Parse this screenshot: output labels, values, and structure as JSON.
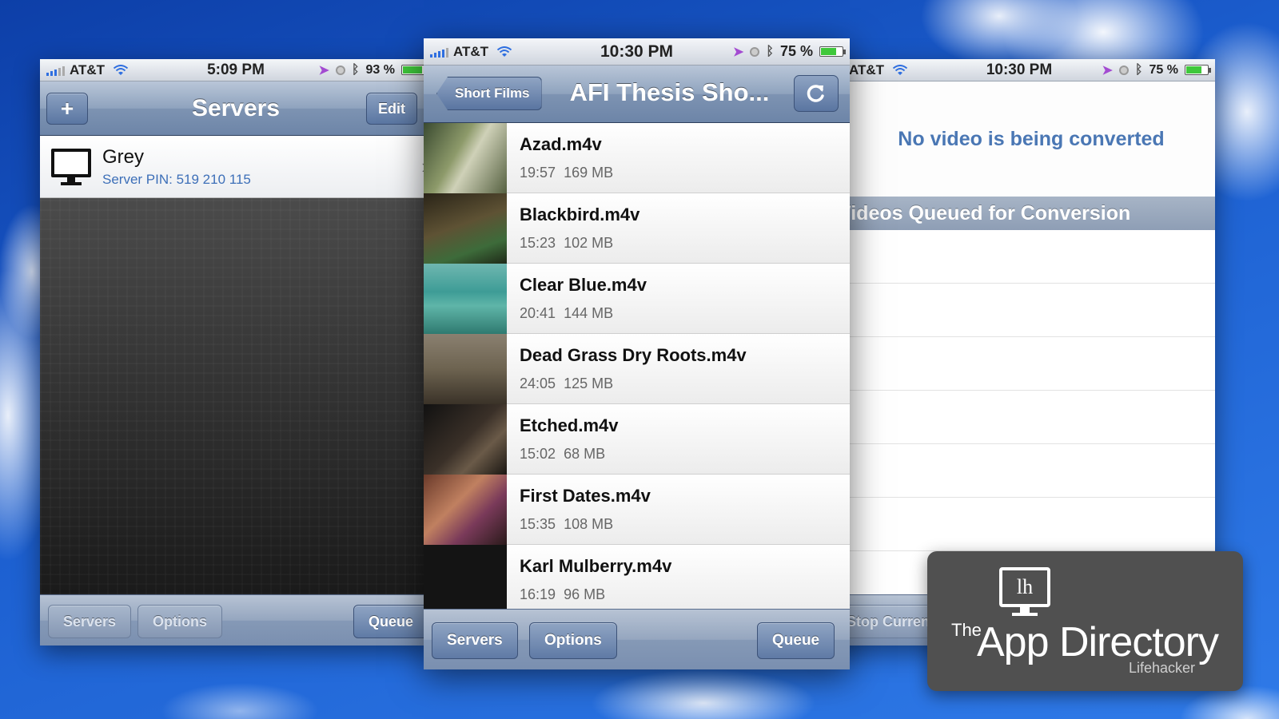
{
  "left_phone": {
    "status": {
      "carrier": "AT&T",
      "time": "5:09 PM",
      "battery": "93 %",
      "battery_level": 0.93
    },
    "nav": {
      "add_label": "+",
      "title": "Servers",
      "edit_label": "Edit"
    },
    "server": {
      "name": "Grey",
      "pin": "Server PIN:  519 210 115"
    },
    "toolbar": {
      "servers": "Servers",
      "options": "Options",
      "queue": "Queue"
    }
  },
  "center_phone": {
    "status": {
      "carrier": "AT&T",
      "time": "10:30 PM",
      "battery": "75 %",
      "battery_level": 0.75
    },
    "nav": {
      "back_label": "Short Films",
      "title": "AFI Thesis Sho...",
      "refresh_icon": "refresh-icon"
    },
    "files": [
      {
        "name": "Azad.m4v",
        "duration": "19:57",
        "size": "169 MB"
      },
      {
        "name": "Blackbird.m4v",
        "duration": "15:23",
        "size": "102 MB"
      },
      {
        "name": "Clear Blue.m4v",
        "duration": "20:41",
        "size": "144 MB"
      },
      {
        "name": "Dead Grass Dry Roots.m4v",
        "duration": "24:05",
        "size": "125 MB"
      },
      {
        "name": "Etched.m4v",
        "duration": "15:02",
        "size": "68 MB"
      },
      {
        "name": "First Dates.m4v",
        "duration": "15:35",
        "size": "108 MB"
      },
      {
        "name": "Karl Mulberry.m4v",
        "duration": "16:19",
        "size": "96 MB"
      }
    ],
    "toolbar": {
      "servers": "Servers",
      "options": "Options",
      "queue": "Queue"
    }
  },
  "right_phone": {
    "status": {
      "carrier": "AT&T",
      "time": "10:30 PM",
      "battery": "75 %",
      "battery_level": 0.75
    },
    "no_video_message": "No video is being converted",
    "queue_header": "Videos Queued for Conversion",
    "toolbar": {
      "stop_current": "Stop Curren"
    }
  },
  "badge": {
    "logo_glyph": "lh",
    "the": "The",
    "title": "App Directory",
    "subtitle": "Lifehacker"
  },
  "colors": {
    "sky": "#1c5fd0",
    "nav_blue": "#7d93b2",
    "link_blue": "#4a77b4",
    "battery_green": "#3fc83b",
    "badge_gray": "#505050"
  }
}
